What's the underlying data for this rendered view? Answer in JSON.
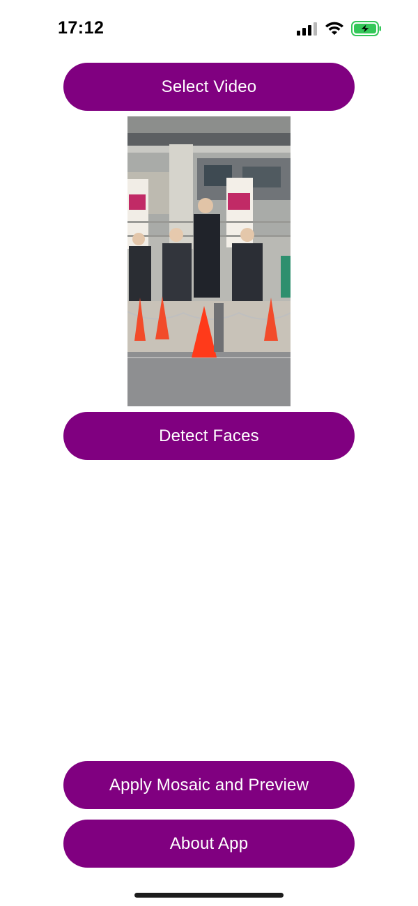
{
  "status_bar": {
    "time": "17:12",
    "icons": [
      "cellular-signal-icon",
      "wifi-icon",
      "battery-charging-icon"
    ],
    "battery_color": "#34c759"
  },
  "buttons": {
    "select_video": "Select Video",
    "detect_faces": "Detect Faces",
    "apply_mosaic": "Apply Mosaic and Preview",
    "about_app": "About App"
  },
  "colors": {
    "accent": "#800080",
    "button_text": "#ffffff",
    "background": "#ffffff"
  },
  "video_preview": {
    "description_icon": "video-thumbnail"
  }
}
